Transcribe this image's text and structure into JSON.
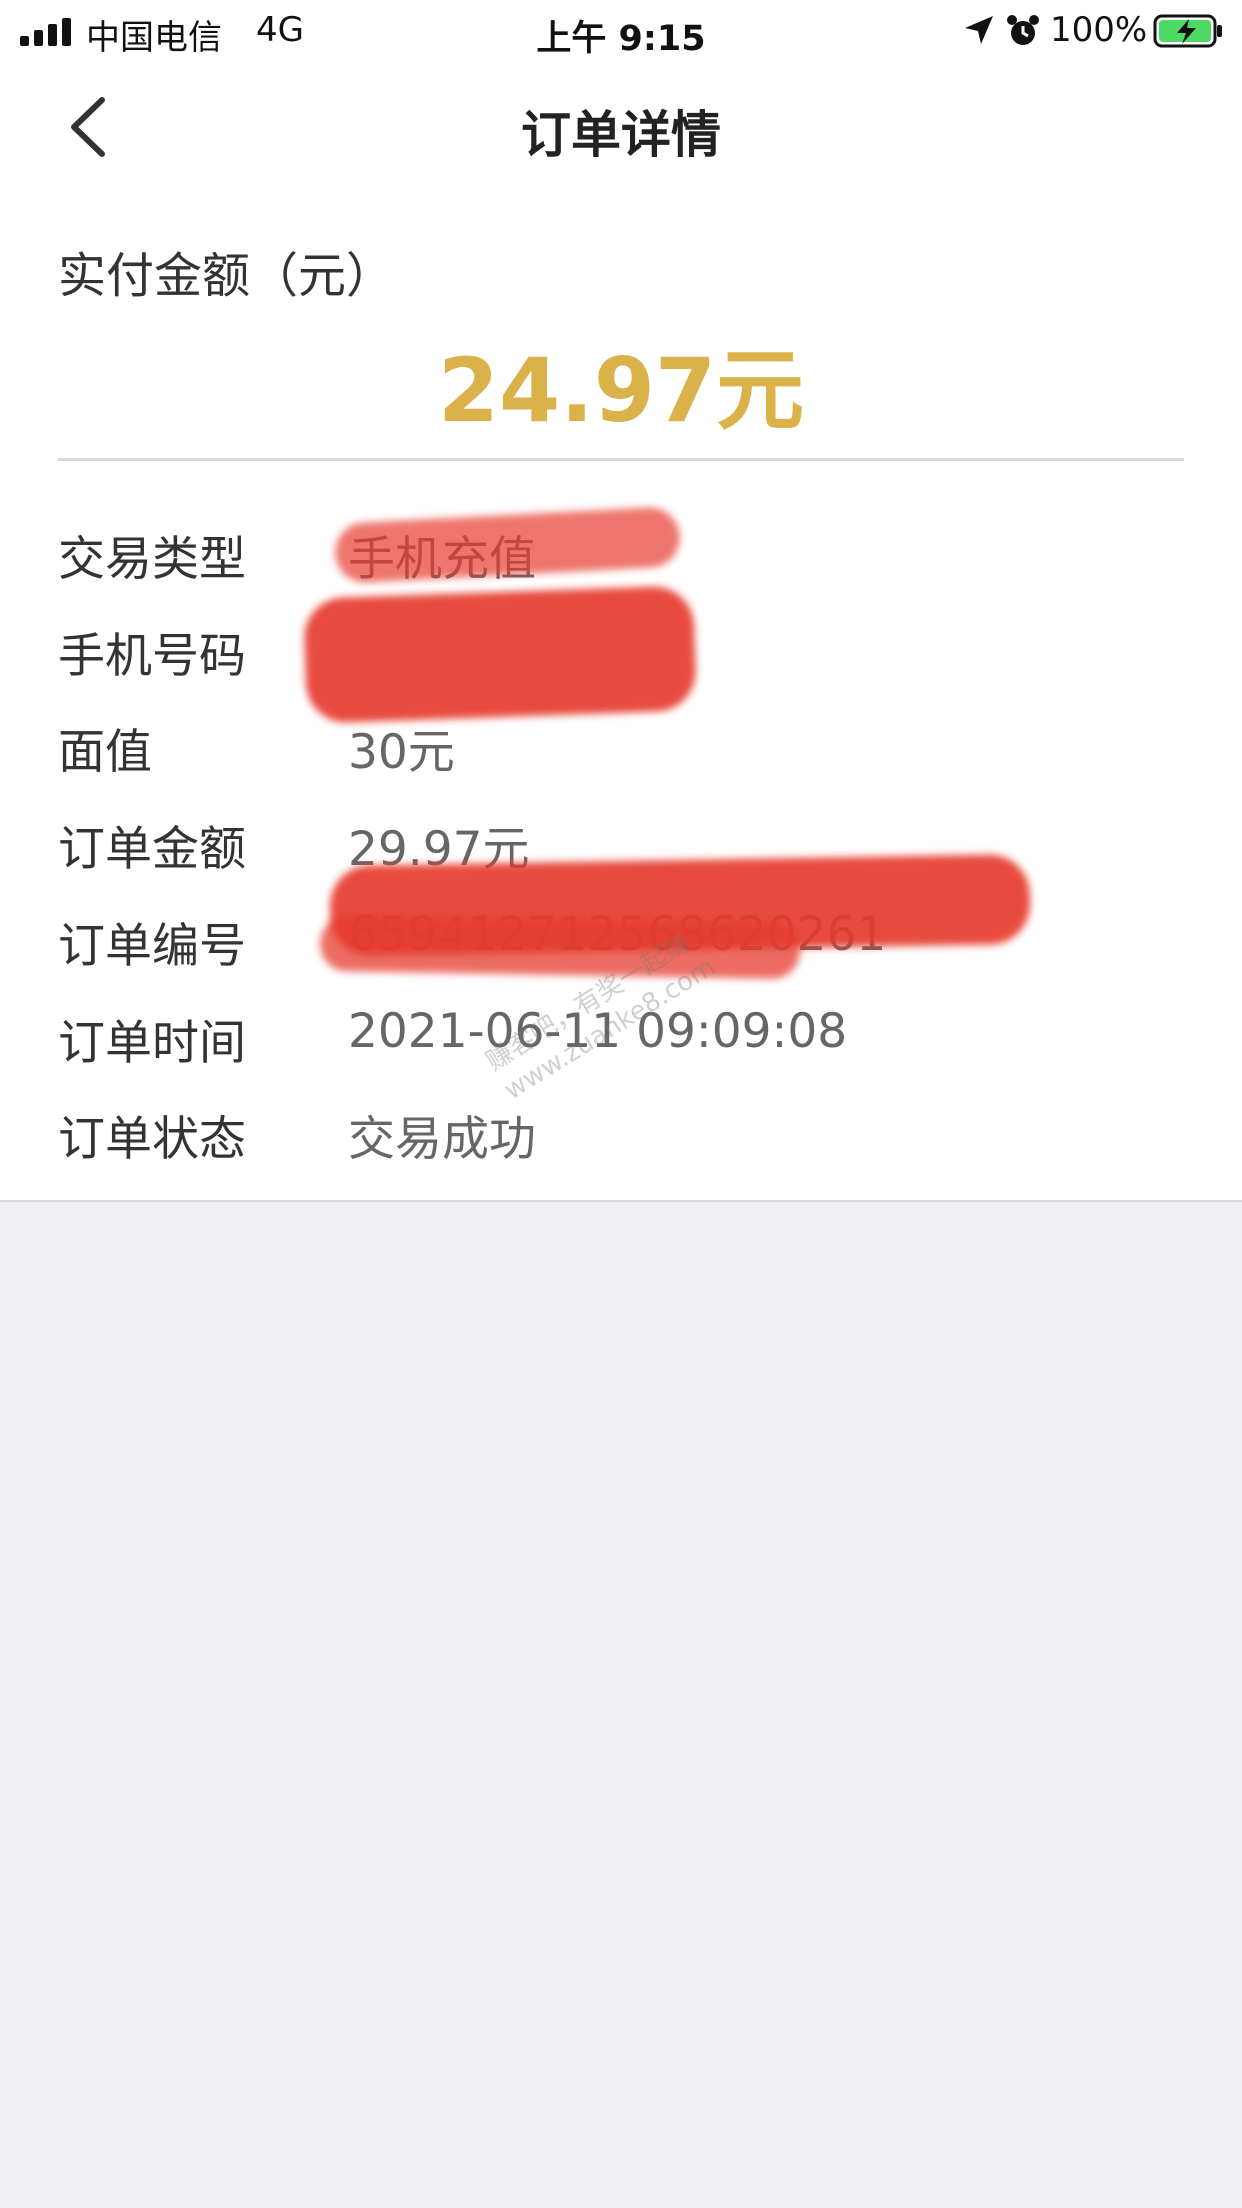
{
  "status_bar": {
    "carrier": "中国电信",
    "network": "4G",
    "time": "上午 9:15",
    "battery_percent": "100%",
    "icons": [
      "signal-icon",
      "location-icon",
      "alarm-icon",
      "battery-charging-icon"
    ]
  },
  "nav": {
    "title": "订单详情",
    "back_icon": "chevron-left-icon"
  },
  "payment": {
    "label": "实付金额（元）",
    "amount": "24.97元",
    "amount_color": "#dbb14a"
  },
  "details": [
    {
      "key": "交易类型",
      "value": "手机充值"
    },
    {
      "key": "手机号码",
      "value": ""
    },
    {
      "key": "面值",
      "value": "30元"
    },
    {
      "key": "订单金额",
      "value": "29.97元"
    },
    {
      "key": "订单编号",
      "value": "659412712568620261"
    },
    {
      "key": "订单时间",
      "value": "2021-06-11 09:09:08"
    },
    {
      "key": "订单状态",
      "value": "交易成功"
    }
  ],
  "watermark": {
    "line1": "赚客吧，有奖一起赚",
    "line2": "www.zuanke8.com"
  },
  "colors": {
    "redaction": "#e63b2e",
    "background": "#efeff4"
  }
}
